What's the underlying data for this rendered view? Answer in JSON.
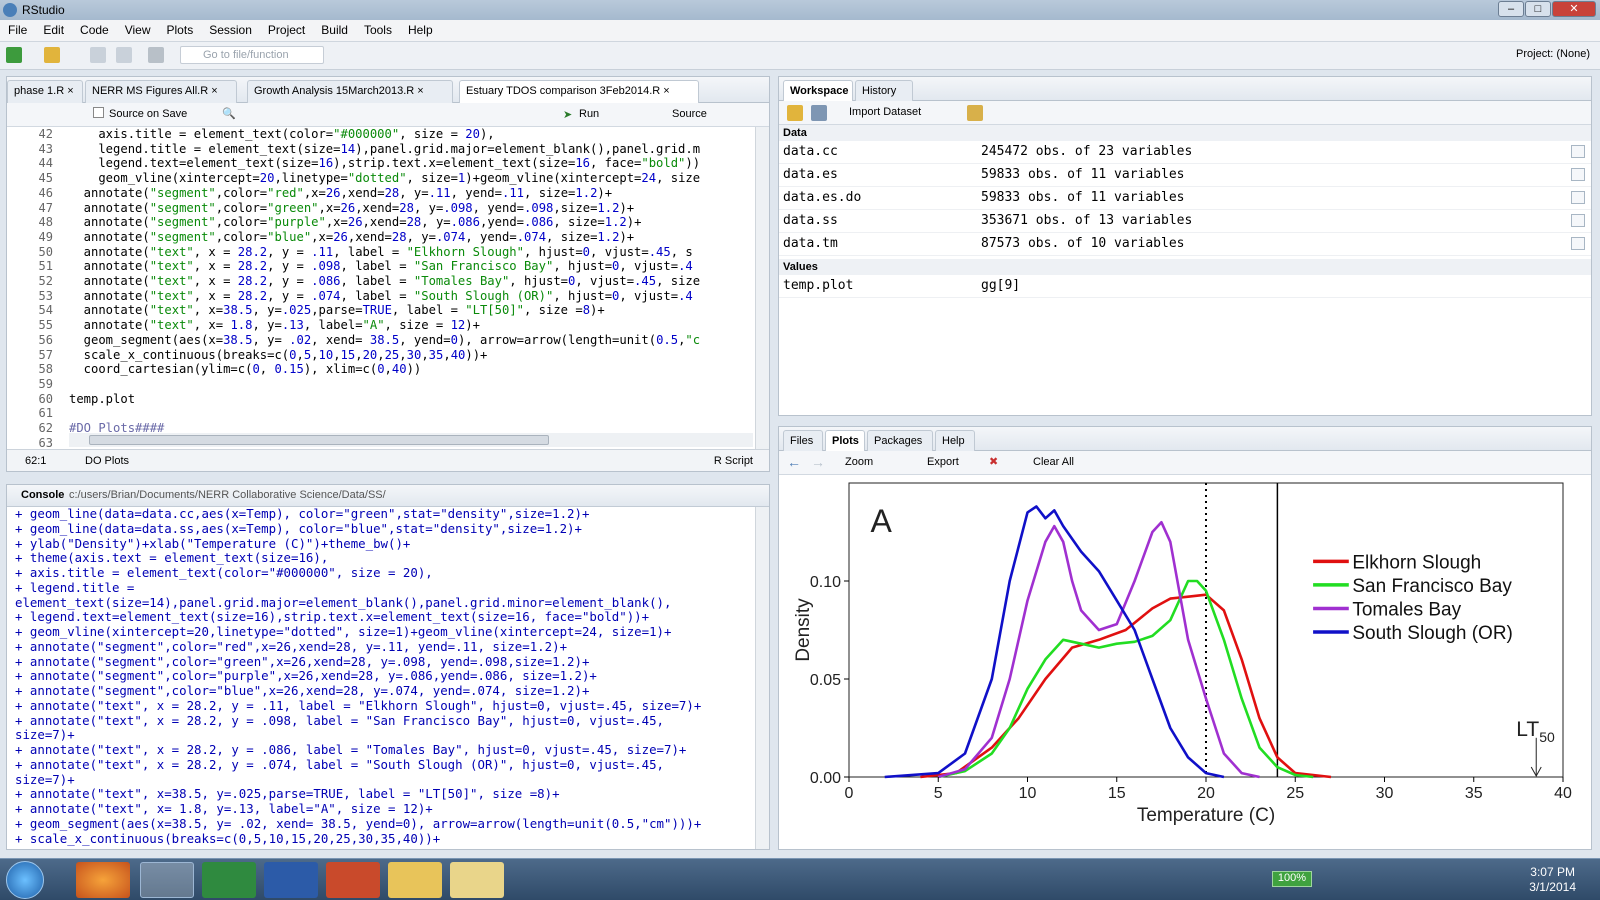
{
  "window": {
    "title": "RStudio"
  },
  "menu": [
    "File",
    "Edit",
    "Code",
    "View",
    "Plots",
    "Session",
    "Project",
    "Build",
    "Tools",
    "Help"
  ],
  "toolbar": {
    "goto_placeholder": "Go to file/function",
    "project": "Project: (None)"
  },
  "editor": {
    "tabs": [
      "phase 1.R",
      "NERR MS Figures All.R",
      "Growth Analysis 15March2013.R",
      "Estuary TDOS comparison 3Feb2014.R"
    ],
    "source_on_save": "Source on Save",
    "run": "Run",
    "source": "Source",
    "status_pos": "62:1",
    "status_section": "DO Plots",
    "status_type": "R Script",
    "line_numbers": [
      "42",
      "43",
      "44",
      "45",
      "46",
      "47",
      "48",
      "49",
      "50",
      "51",
      "52",
      "53",
      "54",
      "55",
      "56",
      "57",
      "58",
      "59",
      "60",
      "61",
      "62",
      "63"
    ]
  },
  "console": {
    "title": "Console",
    "path": "c:/users/Brian/Documents/NERR Collaborative Science/Data/SS/"
  },
  "workspace": {
    "tabs": [
      "Workspace",
      "History"
    ],
    "import": "Import Dataset",
    "data_header": "Data",
    "values_header": "Values",
    "data": [
      {
        "name": "data.cc",
        "desc": "245472 obs. of 23 variables"
      },
      {
        "name": "data.es",
        "desc": "59833 obs. of 11 variables"
      },
      {
        "name": "data.es.do",
        "desc": "59833 obs. of 11 variables"
      },
      {
        "name": "data.ss",
        "desc": "353671 obs. of 13 variables"
      },
      {
        "name": "data.tm",
        "desc": "87573 obs. of 10 variables"
      }
    ],
    "values": [
      {
        "name": "temp.plot",
        "desc": "gg[9]"
      }
    ]
  },
  "plots": {
    "tabs": [
      "Files",
      "Plots",
      "Packages",
      "Help"
    ],
    "zoom": "Zoom",
    "export": "Export",
    "clear": "Clear All"
  },
  "chart_data": {
    "type": "line",
    "panel_label": "A",
    "xlabel": "Temperature (C)",
    "ylabel": "Density",
    "xlim": [
      0,
      40
    ],
    "ylim": [
      0,
      0.15
    ],
    "x_ticks": [
      "0",
      "5",
      "10",
      "15",
      "20",
      "25",
      "30",
      "35",
      "40"
    ],
    "y_ticks": [
      "0.00",
      "0.05",
      "0.10"
    ],
    "vlines": [
      {
        "x": 20,
        "style": "dotted"
      },
      {
        "x": 24,
        "style": "solid"
      }
    ],
    "annotation": {
      "text": "LT",
      "sub": "50",
      "x": 38.5
    },
    "legend_position": "top-right",
    "series": [
      {
        "name": "Elkhorn Slough",
        "color": "#e01010",
        "points": [
          [
            4,
            0
          ],
          [
            6,
            0.002
          ],
          [
            8,
            0.015
          ],
          [
            9.5,
            0.03
          ],
          [
            11,
            0.05
          ],
          [
            12.5,
            0.066
          ],
          [
            14,
            0.07
          ],
          [
            15.5,
            0.075
          ],
          [
            17,
            0.086
          ],
          [
            18,
            0.091
          ],
          [
            19,
            0.092
          ],
          [
            20,
            0.093
          ],
          [
            21,
            0.085
          ],
          [
            22,
            0.06
          ],
          [
            23,
            0.03
          ],
          [
            24,
            0.01
          ],
          [
            25,
            0.002
          ],
          [
            27,
            0
          ]
        ]
      },
      {
        "name": "San Francisco Bay",
        "color": "#22dd22",
        "points": [
          [
            5,
            0
          ],
          [
            6.5,
            0.003
          ],
          [
            8,
            0.012
          ],
          [
            9,
            0.025
          ],
          [
            10,
            0.045
          ],
          [
            11,
            0.06
          ],
          [
            12,
            0.07
          ],
          [
            13,
            0.068
          ],
          [
            14,
            0.066
          ],
          [
            15,
            0.068
          ],
          [
            16,
            0.069
          ],
          [
            17,
            0.072
          ],
          [
            18,
            0.08
          ],
          [
            19,
            0.1
          ],
          [
            19.5,
            0.1
          ],
          [
            20,
            0.095
          ],
          [
            21,
            0.07
          ],
          [
            22,
            0.04
          ],
          [
            23,
            0.015
          ],
          [
            24,
            0.005
          ],
          [
            25,
            0.001
          ],
          [
            26,
            0
          ]
        ]
      },
      {
        "name": "Tomales Bay",
        "color": "#a030d0",
        "points": [
          [
            5,
            0
          ],
          [
            6.5,
            0.004
          ],
          [
            8,
            0.02
          ],
          [
            9,
            0.05
          ],
          [
            10,
            0.09
          ],
          [
            11,
            0.12
          ],
          [
            11.5,
            0.128
          ],
          [
            12,
            0.12
          ],
          [
            12.5,
            0.1
          ],
          [
            13,
            0.085
          ],
          [
            13.5,
            0.08
          ],
          [
            14,
            0.075
          ],
          [
            15,
            0.078
          ],
          [
            16,
            0.1
          ],
          [
            17,
            0.125
          ],
          [
            17.5,
            0.13
          ],
          [
            18,
            0.12
          ],
          [
            18.5,
            0.095
          ],
          [
            19,
            0.07
          ],
          [
            20,
            0.04
          ],
          [
            21,
            0.012
          ],
          [
            22,
            0.002
          ],
          [
            23,
            0
          ]
        ]
      },
      {
        "name": "South Slough (OR)",
        "color": "#1010c8",
        "points": [
          [
            2,
            0
          ],
          [
            5,
            0.002
          ],
          [
            6.5,
            0.012
          ],
          [
            8,
            0.05
          ],
          [
            9,
            0.1
          ],
          [
            10,
            0.135
          ],
          [
            10.5,
            0.138
          ],
          [
            11,
            0.132
          ],
          [
            11.5,
            0.136
          ],
          [
            12,
            0.128
          ],
          [
            13,
            0.115
          ],
          [
            14,
            0.105
          ],
          [
            15,
            0.09
          ],
          [
            16,
            0.075
          ],
          [
            17,
            0.05
          ],
          [
            18,
            0.025
          ],
          [
            19,
            0.01
          ],
          [
            20,
            0.002
          ],
          [
            21,
            0
          ]
        ]
      }
    ]
  },
  "taskbar": {
    "battery": "100%",
    "time": "3:07 PM",
    "date": "3/1/2014"
  }
}
